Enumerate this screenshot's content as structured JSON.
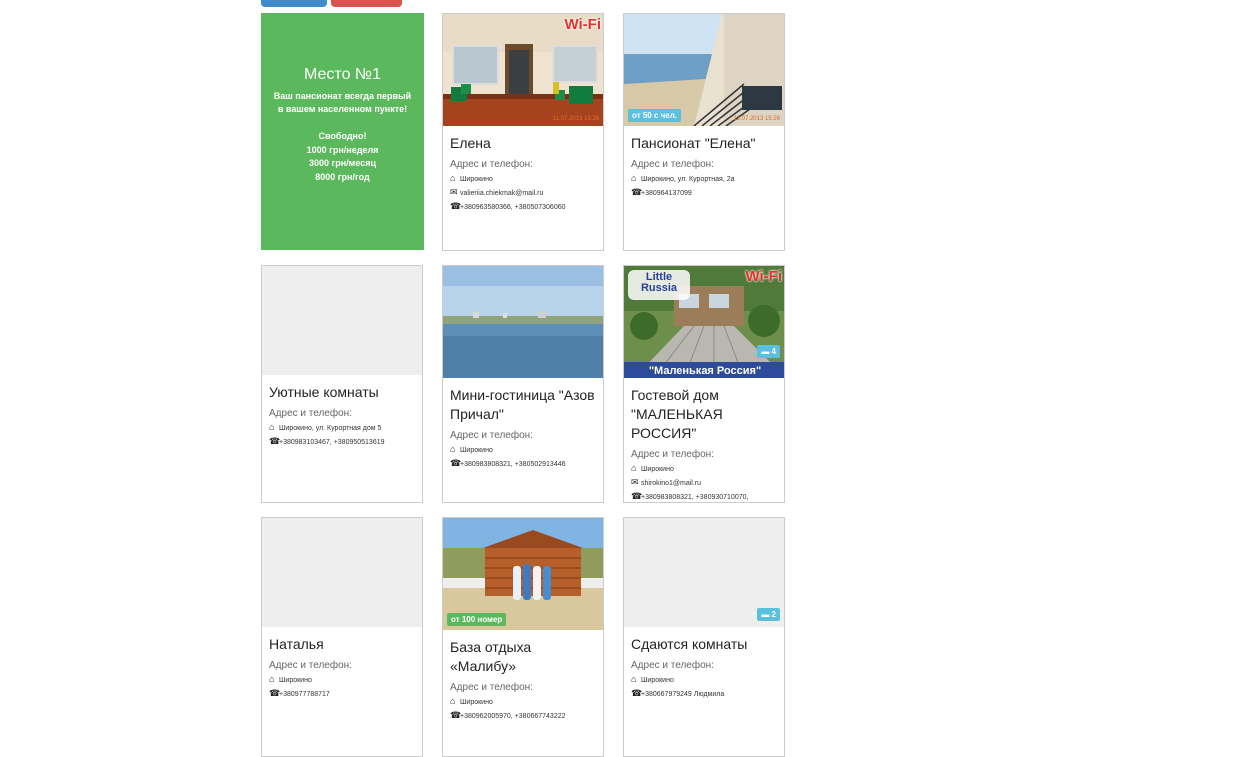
{
  "promo": {
    "title": "Место №1",
    "line1": "Ваш пансионат всегда первый",
    "line2": "в вашем населенном пункте!",
    "free": "Свободно!",
    "price_week": "1000 грн/неделя",
    "price_month": "3000 грн/месяц",
    "price_year": "8000 грн/год"
  },
  "address_label": "Адрес и телефон:",
  "cards": [
    {
      "title": "Елена",
      "wifi": "Wi-Fi",
      "stamp": "11.07.2013 15:26",
      "address": "Широкино",
      "email": "valieriia.chiekmak@mail.ru",
      "phone": "+380963580366, +380507306060"
    },
    {
      "title": "Пансионат \"Елена\"",
      "badge": "от 50 с чел.",
      "stamp": "11.07.2013 15:26",
      "address": "Широкино, ул. Курортная, 2а",
      "phone": "+380964137099"
    },
    {
      "title": "Уютные комнаты",
      "address": "Широкино, ул. Курортная дом 5",
      "phone": "+380983103467, +380950513619"
    },
    {
      "title": "Мини-гостиница \"Азов Причал\"",
      "address": "Широкино",
      "phone": "+380983808321, +380502913446"
    },
    {
      "title": "Гостевой дом \"МАЛЕНЬКАЯ РОССИЯ\"",
      "wifi": "Wi-Fi",
      "logo": "Little Russia",
      "banner": "\"Маленькая Россия\"",
      "comments": "4",
      "address": "Широкино",
      "email": "shirokino1@mail.ru",
      "phone": "+380983808321, +380930710070,"
    },
    {
      "title": "Наталья",
      "address": "Широкино",
      "phone": "+380977788717"
    },
    {
      "title": "База отдыха «Малибу»",
      "badge": "от 100 номер",
      "address": "Широкино",
      "phone": "+380962005970, +380667743222"
    },
    {
      "title": "Сдаются комнаты",
      "comments": "2",
      "address": "Широкино",
      "phone": "+380667979249 Людмила"
    }
  ],
  "icons": {
    "address": "home-icon",
    "email": "envelope-icon",
    "phone": "phone-icon",
    "comments": "comment-icon"
  },
  "colors": {
    "promo": "#5cb85c",
    "info_badge": "#5bc0de",
    "success_badge": "#5cb85c",
    "top_button_blue": "#428bca",
    "top_button_red": "#d9534f"
  }
}
